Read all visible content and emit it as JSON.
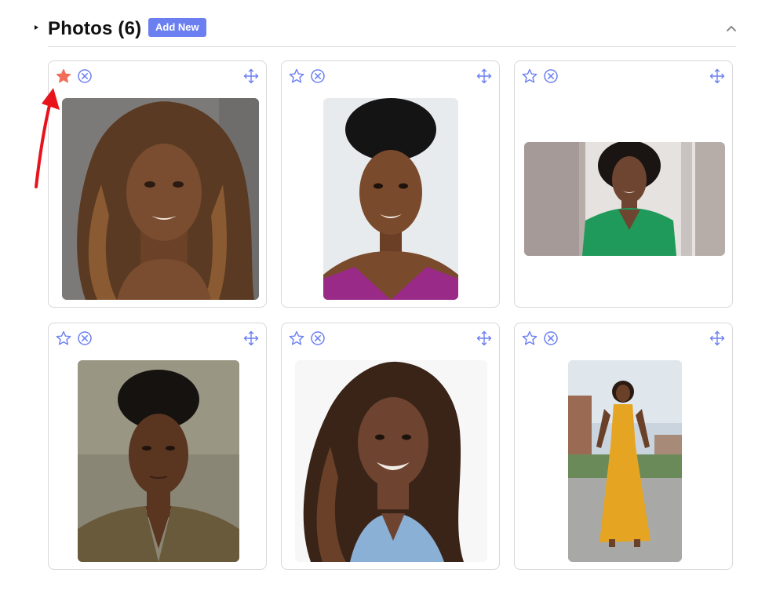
{
  "header": {
    "title": "Photos (6)",
    "add_button": "Add New"
  },
  "colors": {
    "accent": "#6b7ff0",
    "icon": "#6b7ff0",
    "star_active": "#f26d58",
    "arrow": "#e8141c",
    "border": "#d8d8d8"
  },
  "photos": [
    {
      "primary": true,
      "icons": [
        "star-icon",
        "remove-icon",
        "move-icon"
      ]
    },
    {
      "primary": false,
      "icons": [
        "star-icon",
        "remove-icon",
        "move-icon"
      ]
    },
    {
      "primary": false,
      "icons": [
        "star-icon",
        "remove-icon",
        "move-icon"
      ]
    },
    {
      "primary": false,
      "icons": [
        "star-icon",
        "remove-icon",
        "move-icon"
      ]
    },
    {
      "primary": false,
      "icons": [
        "star-icon",
        "remove-icon",
        "move-icon"
      ]
    },
    {
      "primary": false,
      "icons": [
        "star-icon",
        "remove-icon",
        "move-icon"
      ]
    }
  ]
}
